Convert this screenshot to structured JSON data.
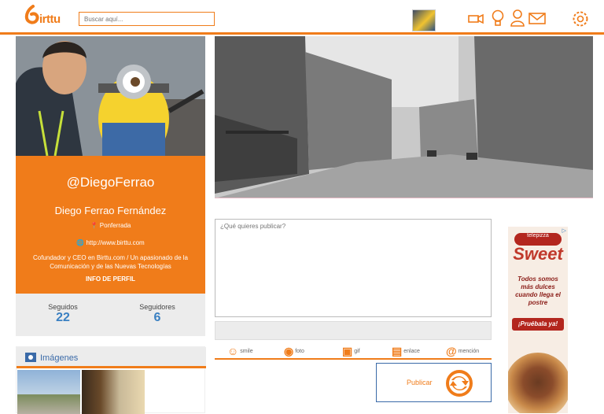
{
  "header": {
    "logo_text": "irttu",
    "search_placeholder": "Buscar aquí...",
    "icons": [
      "video-camera-icon",
      "lightbulb-icon",
      "user-icon",
      "mail-icon",
      "gear-icon"
    ],
    "accent": "#f07c1a"
  },
  "profile": {
    "handle": "@DiegoFerrao",
    "full_name": "Diego Ferrao Fernández",
    "city": "Ponferrada",
    "website": "http://www.birttu.com",
    "bio": "Cofundador y CEO en Birttu.com / Un apasionado de la Comunicación y de las Nuevas Tecnologías",
    "info_link": "INFO DE PERFIL"
  },
  "stats": {
    "following_label": "Seguidos",
    "following_count": "22",
    "followers_label": "Seguidores",
    "followers_count": "6"
  },
  "images_section": {
    "title": "Imágenes"
  },
  "composer": {
    "placeholder": "¿Qué quieres publicar?",
    "actions": [
      {
        "icon": "smile-icon",
        "label": "smile"
      },
      {
        "icon": "camera-icon",
        "label": "foto"
      },
      {
        "icon": "gif-icon",
        "label": "gif"
      },
      {
        "icon": "link-icon",
        "label": "enlace"
      },
      {
        "icon": "at-icon",
        "label": "mención"
      }
    ],
    "publish_label": "Publicar"
  },
  "ad": {
    "brand": "telepizza",
    "headline": "Sweet",
    "body": "Todos somos más dulces cuando llega el postre",
    "cta": "¡Pruébala ya!",
    "choice": "▷"
  }
}
